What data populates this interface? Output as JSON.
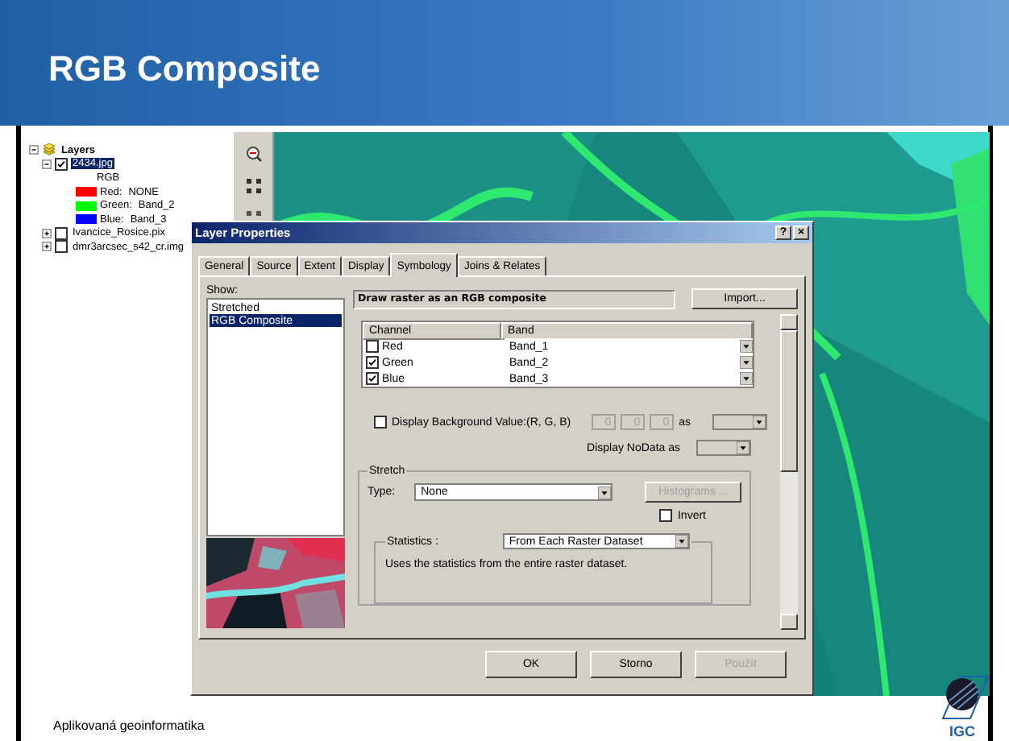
{
  "slide": {
    "title": "RGB Composite",
    "footer": "Aplikovaná geoinformatika",
    "logo_text": "IGC"
  },
  "toc": {
    "label": "Layers",
    "expanded": true,
    "children": [
      {
        "label": "2434.jpg",
        "checked": true,
        "selected": true,
        "expanded": true,
        "legend_title": "RGB",
        "legend": [
          {
            "label": "Red:",
            "value": "NONE",
            "color": "#ff0000"
          },
          {
            "label": "Green:",
            "value": "Band_2",
            "color": "#00ff00"
          },
          {
            "label": "Blue:",
            "value": "Band_3",
            "color": "#0000ff"
          }
        ]
      },
      {
        "label": "Ivancice_Rosice.pix",
        "checked": false,
        "selected": false,
        "expanded": false
      },
      {
        "label": "dmr3arcsec_s42_cr.img",
        "checked": false,
        "selected": false,
        "expanded": false
      }
    ]
  },
  "dialog": {
    "title": "Layer Properties",
    "title_buttons": [
      "?",
      "×"
    ],
    "tabs": [
      {
        "label": "General",
        "selected": false
      },
      {
        "label": "Source",
        "selected": false
      },
      {
        "label": "Extent",
        "selected": false
      },
      {
        "label": "Display",
        "selected": false
      },
      {
        "label": "Symbology",
        "selected": true
      },
      {
        "label": "Joins & Relates",
        "selected": false
      }
    ],
    "show_label": "Show:",
    "show_items": [
      {
        "label": "Stretched",
        "selected": false
      },
      {
        "label": "RGB Composite",
        "selected": true
      }
    ],
    "heading": "Draw raster as an RGB composite",
    "import_button": "Import...",
    "columns": [
      "Channel",
      "Band"
    ],
    "channels": [
      {
        "channel": "Red",
        "checked": false,
        "band": "Band_1"
      },
      {
        "channel": "Green",
        "checked": true,
        "band": "Band_2"
      },
      {
        "channel": "Blue",
        "checked": true,
        "band": "Band_3"
      }
    ],
    "background": {
      "checked": false,
      "label": "Display Background Value:(R, G, B)",
      "values": [
        "0",
        "0",
        "0"
      ],
      "as_label": "as"
    },
    "nodata_label": "Display NoData as",
    "stretch": {
      "legend": "Stretch",
      "type_label": "Type:",
      "type_value": "None",
      "histograms": {
        "label": "Histograms ...",
        "disabled": true
      },
      "invert": {
        "label": "Invert",
        "checked": false
      },
      "statistics": {
        "label": "Statistics :",
        "value": "From Each Raster Dataset",
        "description": "Uses the statistics from the entire raster dataset."
      }
    },
    "buttons": [
      {
        "label": "OK",
        "disabled": false
      },
      {
        "label": "Storno",
        "disabled": false
      },
      {
        "label": "Použít",
        "disabled": true
      }
    ]
  }
}
